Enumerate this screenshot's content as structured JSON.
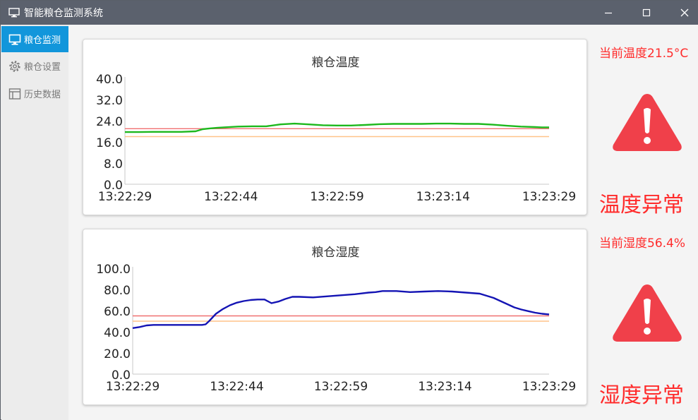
{
  "window": {
    "title": "智能粮仓监测系统",
    "icons": {
      "app": "monitor-icon",
      "minimize": "minimize-icon",
      "maximize": "maximize-icon",
      "close": "close-icon"
    }
  },
  "sidebar": {
    "items": [
      {
        "label": "粮仓监测",
        "icon": "monitor-icon",
        "active": true
      },
      {
        "label": "粮仓设置",
        "icon": "gear-icon",
        "active": false
      },
      {
        "label": "历史数据",
        "icon": "table-icon",
        "active": false
      }
    ],
    "active_color": "#1296db"
  },
  "temperature": {
    "current": "当前温度21.5°C",
    "status": "温度异常",
    "warning_icon": "warning-icon",
    "alert_color": "#ff2b2b"
  },
  "humidity": {
    "current": "当前湿度56.4%",
    "status": "湿度异常",
    "warning_icon": "warning-icon",
    "alert_color": "#ff2b2b"
  },
  "chart_data": [
    {
      "type": "line",
      "title": "粮仓温度",
      "xlabel": "",
      "ylabel": "",
      "x_ticks": [
        "13:22:29",
        "13:22:44",
        "13:22:59",
        "13:23:14",
        "13:23:29"
      ],
      "y_ticks": [
        "0.0",
        "8.0",
        "16.0",
        "24.0",
        "32.0",
        "40.0"
      ],
      "ylim": [
        0,
        40
      ],
      "grid": false,
      "series": [
        {
          "color": "#1db81d",
          "x": [
            0,
            2,
            4,
            6,
            8,
            10,
            11,
            12,
            13,
            14,
            16,
            18,
            20,
            22,
            24,
            26,
            28,
            30,
            32,
            34,
            36,
            38,
            40,
            42,
            44,
            46,
            48,
            50,
            52,
            54,
            56,
            58,
            59,
            60
          ],
          "values": [
            19.7,
            19.7,
            19.8,
            19.8,
            19.8,
            20.0,
            20.8,
            21.1,
            21.3,
            21.5,
            21.8,
            21.9,
            21.9,
            22.6,
            22.9,
            22.6,
            22.3,
            22.2,
            22.2,
            22.4,
            22.7,
            22.8,
            22.8,
            22.8,
            22.9,
            22.9,
            22.8,
            22.8,
            22.5,
            22.1,
            21.8,
            21.6,
            21.5,
            21.5
          ]
        },
        {
          "color": "#f07070",
          "x": [
            0,
            60
          ],
          "values": [
            21.0,
            21.0
          ]
        },
        {
          "color": "#ffc48a",
          "x": [
            0,
            60
          ],
          "values": [
            18.0,
            18.0
          ]
        }
      ]
    },
    {
      "type": "line",
      "title": "粮仓湿度",
      "xlabel": "",
      "ylabel": "",
      "x_ticks": [
        "13:22:29",
        "13:22:44",
        "13:22:59",
        "13:23:14",
        "13:23:29"
      ],
      "y_ticks": [
        "0.0",
        "20.0",
        "40.0",
        "60.0",
        "80.0",
        "100.0"
      ],
      "ylim": [
        0,
        100
      ],
      "grid": false,
      "series": [
        {
          "color": "#1414b4",
          "x": [
            0,
            1,
            2,
            3,
            4,
            6,
            8,
            10,
            10.5,
            11,
            12,
            13,
            14,
            15,
            16,
            17,
            18,
            19,
            20,
            21,
            22,
            23,
            24,
            26,
            28,
            30,
            32,
            34,
            35,
            36,
            38,
            40,
            42,
            44,
            46,
            48,
            50,
            52,
            54,
            55,
            56,
            57,
            58,
            59,
            60
          ],
          "values": [
            43.5,
            44.5,
            46,
            46.5,
            46.5,
            46.5,
            46.5,
            46.5,
            47,
            50,
            57,
            61.5,
            65,
            67.5,
            69,
            70,
            70.5,
            70.5,
            67,
            68.5,
            71,
            73,
            73,
            72.5,
            73.5,
            74.5,
            75.5,
            77,
            77.5,
            78.5,
            78.5,
            77.5,
            78,
            78.5,
            78,
            77,
            76,
            72,
            66,
            63,
            61,
            59.5,
            58,
            57,
            56.4
          ]
        },
        {
          "color": "#f07070",
          "x": [
            0,
            60
          ],
          "values": [
            55.0,
            55.0
          ]
        },
        {
          "color": "#ffc48a",
          "x": [
            0,
            60
          ],
          "values": [
            50.0,
            50.0
          ]
        }
      ]
    }
  ]
}
